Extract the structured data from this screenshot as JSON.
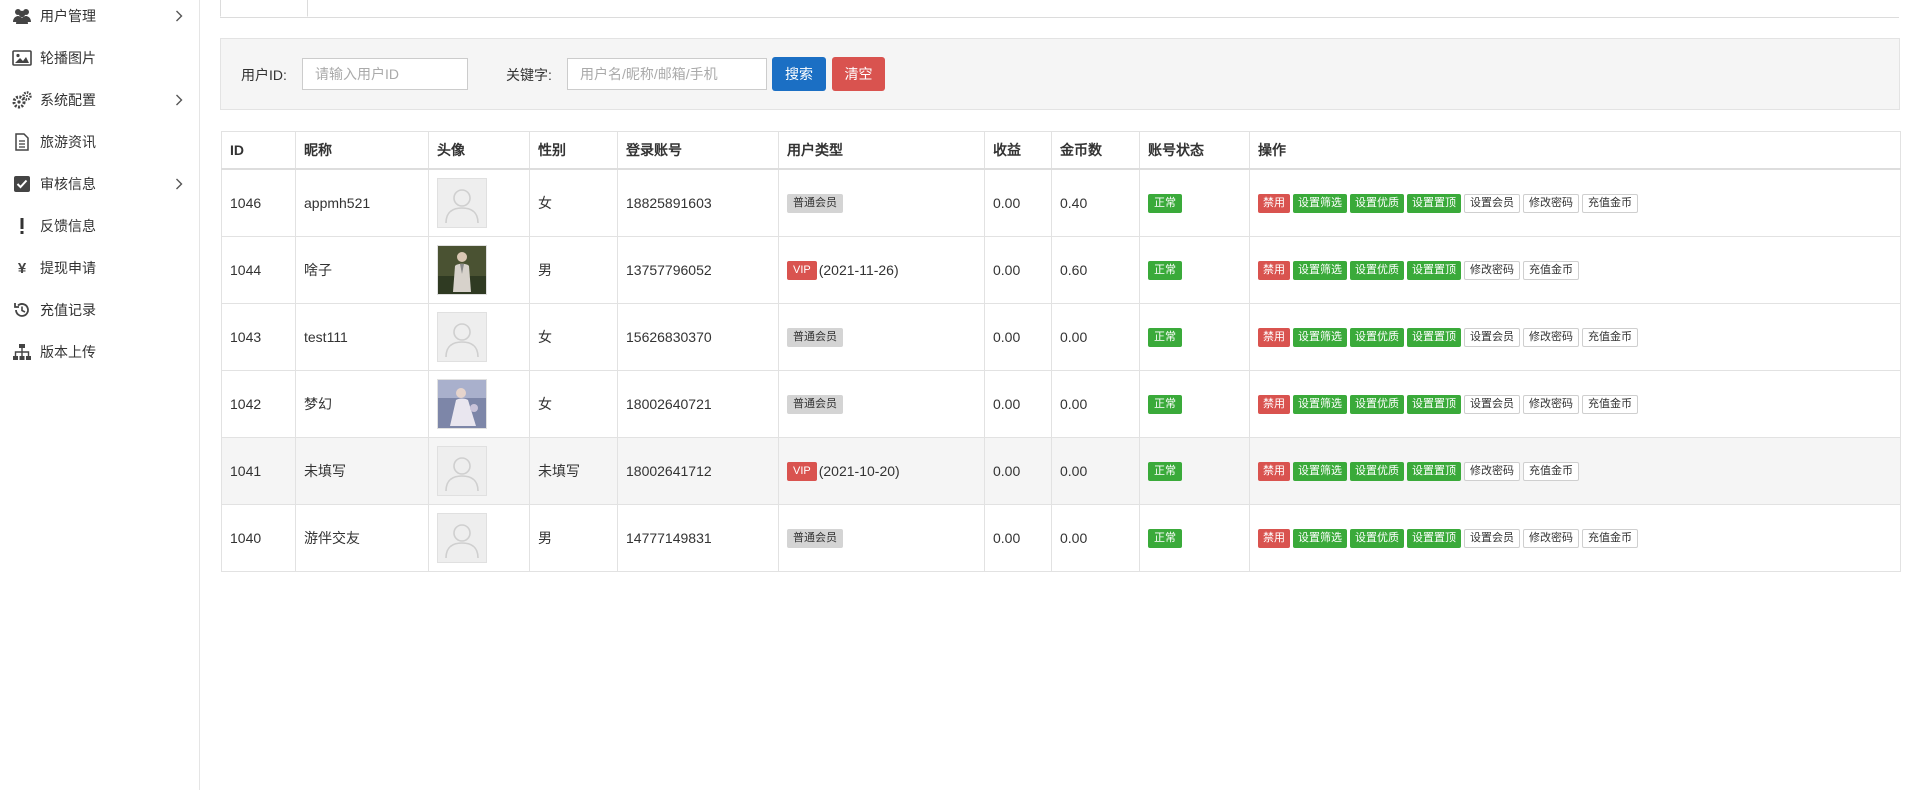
{
  "sidebar": {
    "items": [
      {
        "label": "用户管理",
        "icon": "users-icon",
        "has_submenu": true
      },
      {
        "label": "轮播图片",
        "icon": "image-icon",
        "has_submenu": false
      },
      {
        "label": "系统配置",
        "icon": "cogs-icon",
        "has_submenu": true
      },
      {
        "label": "旅游资讯",
        "icon": "document-icon",
        "has_submenu": false
      },
      {
        "label": "审核信息",
        "icon": "checkbox-icon",
        "has_submenu": true
      },
      {
        "label": "反馈信息",
        "icon": "exclamation-icon",
        "has_submenu": false
      },
      {
        "label": "提现申请",
        "icon": "yen-icon",
        "has_submenu": false
      },
      {
        "label": "充值记录",
        "icon": "history-icon",
        "has_submenu": false
      },
      {
        "label": "版本上传",
        "icon": "sitemap-icon",
        "has_submenu": false
      }
    ]
  },
  "search": {
    "user_id_label": "用户ID:",
    "user_id_placeholder": "请输入用户ID",
    "keyword_label": "关键字:",
    "keyword_placeholder": "用户名/昵称/邮箱/手机",
    "search_button": "搜索",
    "clear_button": "清空"
  },
  "table": {
    "headers": [
      "ID",
      "昵称",
      "头像",
      "性别",
      "登录账号",
      "用户类型",
      "收益",
      "金币数",
      "账号状态",
      "操作"
    ],
    "rows": [
      {
        "id": "1046",
        "nickname": "appmh521",
        "avatar": "placeholder",
        "gender": "女",
        "account": "18825891603",
        "type_badge": "普通会员",
        "vip": false,
        "vip_date": "",
        "income": "0.00",
        "coins": "0.40",
        "status": "正常",
        "ops": [
          "禁用",
          "设置筛选",
          "设置优质",
          "设置置顶",
          "设置会员",
          "修改密码",
          "充值金币"
        ],
        "hover": false
      },
      {
        "id": "1044",
        "nickname": "啥子",
        "avatar": "photo-suit",
        "gender": "男",
        "account": "13757796052",
        "type_badge": "VIP",
        "vip": true,
        "vip_date": "(2021-11-26)",
        "income": "0.00",
        "coins": "0.60",
        "status": "正常",
        "ops": [
          "禁用",
          "设置筛选",
          "设置优质",
          "设置置顶",
          "修改密码",
          "充值金币"
        ],
        "hover": false
      },
      {
        "id": "1043",
        "nickname": "test111",
        "avatar": "placeholder",
        "gender": "女",
        "account": "15626830370",
        "type_badge": "普通会员",
        "vip": false,
        "vip_date": "",
        "income": "0.00",
        "coins": "0.00",
        "status": "正常",
        "ops": [
          "禁用",
          "设置筛选",
          "设置优质",
          "设置置顶",
          "设置会员",
          "修改密码",
          "充值金币"
        ],
        "hover": false
      },
      {
        "id": "1042",
        "nickname": "梦幻",
        "avatar": "photo-dress",
        "gender": "女",
        "account": "18002640721",
        "type_badge": "普通会员",
        "vip": false,
        "vip_date": "",
        "income": "0.00",
        "coins": "0.00",
        "status": "正常",
        "ops": [
          "禁用",
          "设置筛选",
          "设置优质",
          "设置置顶",
          "设置会员",
          "修改密码",
          "充值金币"
        ],
        "hover": false
      },
      {
        "id": "1041",
        "nickname": "未填写",
        "avatar": "placeholder",
        "gender": "未填写",
        "account": "18002641712",
        "type_badge": "VIP",
        "vip": true,
        "vip_date": "(2021-10-20)",
        "income": "0.00",
        "coins": "0.00",
        "status": "正常",
        "ops": [
          "禁用",
          "设置筛选",
          "设置优质",
          "设置置顶",
          "修改密码",
          "充值金币"
        ],
        "hover": true
      },
      {
        "id": "1040",
        "nickname": "游伴交友",
        "avatar": "placeholder",
        "gender": "男",
        "account": "14777149831",
        "type_badge": "普通会员",
        "vip": false,
        "vip_date": "",
        "income": "0.00",
        "coins": "0.00",
        "status": "正常",
        "ops": [
          "禁用",
          "设置筛选",
          "设置优质",
          "设置置顶",
          "设置会员",
          "修改密码",
          "充值金币"
        ],
        "hover": false
      }
    ]
  },
  "colors": {
    "primary": "#1b6fc4",
    "danger": "#d9534f",
    "success": "#3aaa3a"
  }
}
